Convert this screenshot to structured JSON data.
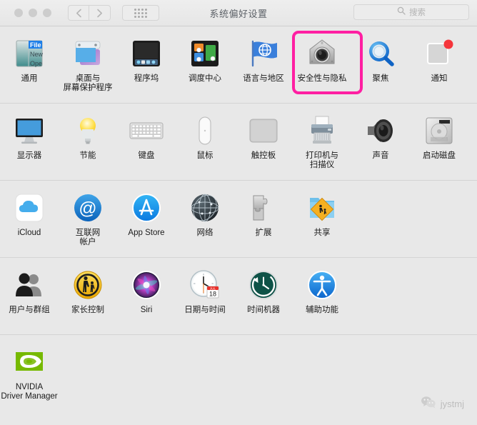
{
  "window": {
    "title": "系统偏好设置",
    "traffic_lights": [
      "close",
      "minimize",
      "zoom"
    ],
    "nav": {
      "back_label": "‹",
      "forward_label": "›"
    },
    "grid_button": "show-all-grid",
    "search": {
      "placeholder": "搜索",
      "value": ""
    }
  },
  "highlight": {
    "target": "安全性与隐私",
    "color": "#ff1fa2"
  },
  "watermark": {
    "icon": "wechat-icon",
    "text": "jystmj"
  },
  "rows": [
    {
      "items": [
        {
          "label": "通用",
          "icon": "general-icon"
        },
        {
          "label": "桌面与\n屏幕保护程序",
          "icon": "desktop-screensaver-icon"
        },
        {
          "label": "程序坞",
          "icon": "dock-icon"
        },
        {
          "label": "调度中心",
          "icon": "mission-control-icon"
        },
        {
          "label": "语言与地区",
          "icon": "language-region-icon"
        },
        {
          "label": "安全性与隐私",
          "icon": "security-privacy-icon"
        },
        {
          "label": "聚焦",
          "icon": "spotlight-icon"
        },
        {
          "label": "通知",
          "icon": "notifications-icon"
        }
      ]
    },
    {
      "items": [
        {
          "label": "显示器",
          "icon": "displays-icon"
        },
        {
          "label": "节能",
          "icon": "energy-saver-icon"
        },
        {
          "label": "键盘",
          "icon": "keyboard-icon"
        },
        {
          "label": "鼠标",
          "icon": "mouse-icon"
        },
        {
          "label": "触控板",
          "icon": "trackpad-icon"
        },
        {
          "label": "打印机与\n扫描仪",
          "icon": "printers-scanners-icon"
        },
        {
          "label": "声音",
          "icon": "sound-icon"
        },
        {
          "label": "启动磁盘",
          "icon": "startup-disk-icon"
        }
      ]
    },
    {
      "items": [
        {
          "label": "iCloud",
          "icon": "icloud-icon"
        },
        {
          "label": "互联网\n帐户",
          "icon": "internet-accounts-icon"
        },
        {
          "label": "App Store",
          "icon": "app-store-icon"
        },
        {
          "label": "网络",
          "icon": "network-icon"
        },
        {
          "label": "扩展",
          "icon": "extensions-icon"
        },
        {
          "label": "共享",
          "icon": "sharing-icon"
        }
      ]
    },
    {
      "items": [
        {
          "label": "用户与群组",
          "icon": "users-groups-icon"
        },
        {
          "label": "家长控制",
          "icon": "parental-controls-icon"
        },
        {
          "label": "Siri",
          "icon": "siri-icon"
        },
        {
          "label": "日期与时间",
          "icon": "date-time-icon"
        },
        {
          "label": "时间机器",
          "icon": "time-machine-icon"
        },
        {
          "label": "辅助功能",
          "icon": "accessibility-icon"
        }
      ]
    },
    {
      "items": [
        {
          "label": "NVIDIA\nDriver Manager",
          "icon": "nvidia-driver-manager-icon"
        }
      ]
    }
  ],
  "icon_details": {
    "general_badge_text": [
      "File",
      "New",
      "Open"
    ],
    "date_time_badge": {
      "month": "JUL",
      "day": "18"
    }
  }
}
